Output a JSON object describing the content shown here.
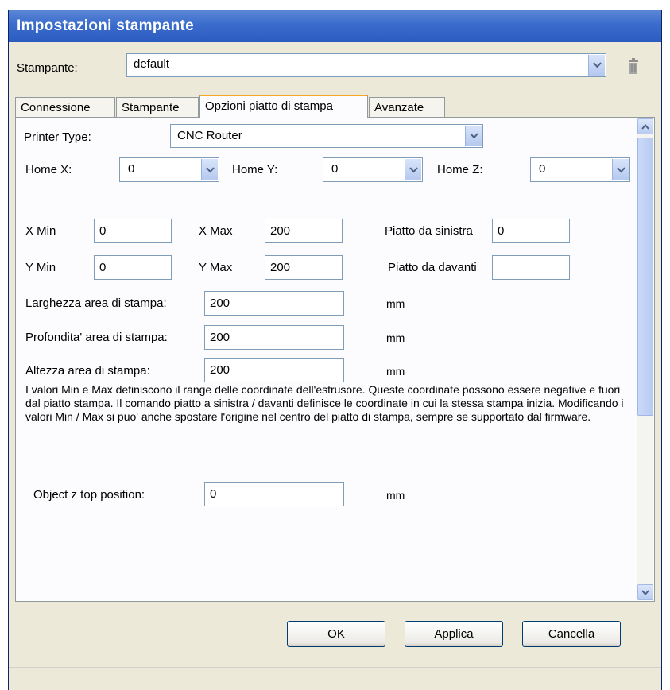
{
  "window": {
    "title": "Impostazioni stampante"
  },
  "printer_row": {
    "label": "Stampante:",
    "value": "default",
    "delete_icon": "trash-icon"
  },
  "tabs": [
    {
      "label": "Connessione"
    },
    {
      "label": "Stampante"
    },
    {
      "label": "Opzioni piatto di stampa"
    },
    {
      "label": "Avanzate"
    }
  ],
  "active_tab": "Opzioni piatto di stampa",
  "printer_type": {
    "label": "Printer Type:",
    "value": "CNC Router"
  },
  "home": {
    "x": {
      "label": "Home X:",
      "value": "0"
    },
    "y": {
      "label": "Home Y:",
      "value": "0"
    },
    "z": {
      "label": "Home Z:",
      "value": "0"
    }
  },
  "limits": {
    "x_min": {
      "label": "X Min",
      "value": "0"
    },
    "x_max": {
      "label": "X Max",
      "value": "200"
    },
    "y_min": {
      "label": "Y Min",
      "value": "0"
    },
    "y_max": {
      "label": "Y Max",
      "value": "200"
    },
    "bed_left": {
      "label": "Piatto da sinistra",
      "value": "0"
    },
    "bed_front": {
      "label": "Piatto da davanti",
      "value": ""
    }
  },
  "area": {
    "width": {
      "label": "Larghezza area di stampa:",
      "value": "200",
      "unit": "mm"
    },
    "depth": {
      "label": "Profondita' area di stampa:",
      "value": "200",
      "unit": "mm"
    },
    "height": {
      "label": "Altezza area di stampa:",
      "value": "200",
      "unit": "mm"
    }
  },
  "description": "I valori Min e Max definiscono il range delle coordinate dell'estrusore. Queste coordinate possono essere negative e fuori dal piatto stampa. Il comando piatto a sinistra / davanti definisce le coordinate in cui la stessa stampa inizia. Modificando i valori Min / Max si puo' anche spostare l'origine nel centro del piatto di stampa, sempre se supportato dal firmware.",
  "object_z": {
    "label": "Object z top position:",
    "value": "0",
    "unit": "mm"
  },
  "buttons": {
    "ok": "OK",
    "apply": "Applica",
    "cancel": "Cancella"
  },
  "colors": {
    "titlebar": "#3a6ccc",
    "tab_highlight": "#f5a623",
    "window_bg": "#ece9d8"
  }
}
